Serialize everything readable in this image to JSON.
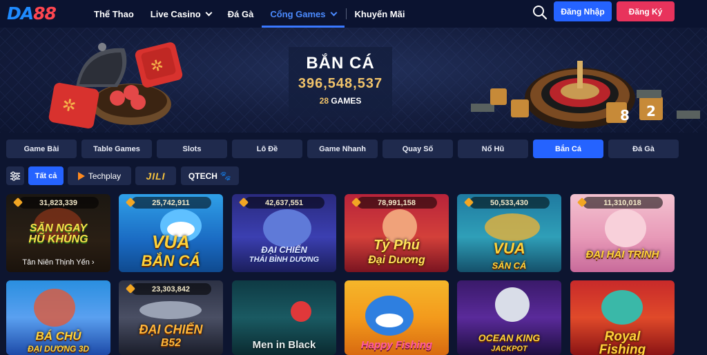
{
  "header": {
    "logo_part1": "DA",
    "logo_part2": "88",
    "nav": [
      {
        "label": "Thể Thao"
      },
      {
        "label": "Live Casino"
      },
      {
        "label": "Đá Gà"
      },
      {
        "label": "Cổng Games"
      },
      {
        "label": "Khuyến Mãi"
      }
    ],
    "login_label": "Đăng Nhập",
    "register_label": "Đăng Ký"
  },
  "banner": {
    "title": "BẮN CÁ",
    "amount": "396,548,537",
    "games_count": "28",
    "games_word": "GAMES"
  },
  "categories": [
    {
      "label": "Game Bài"
    },
    {
      "label": "Table Games"
    },
    {
      "label": "Slots"
    },
    {
      "label": "Lô Đề"
    },
    {
      "label": "Game Nhanh"
    },
    {
      "label": "Quay Số"
    },
    {
      "label": "Nổ Hũ"
    },
    {
      "label": "Bắn Cá",
      "active": true
    },
    {
      "label": "Đá Gà"
    }
  ],
  "providers": {
    "all_label": "Tất cả",
    "techplay_label": "Techplay",
    "jili_label": "JILI",
    "qtech_label": "QTECH"
  },
  "games_row1": [
    {
      "jackpot": "31,823,339",
      "title_line1": "SĂN NGAY",
      "title_line2": "HŨ KHỦNG",
      "subtitle": "Tân Niên Thịnh Yến ›"
    },
    {
      "jackpot": "25,742,911",
      "title_line1": "VUA",
      "title_line2": "BẮN CÁ"
    },
    {
      "jackpot": "42,637,551",
      "title_line1": "ĐẠI CHIẾN",
      "title_line2": "THÁI BÌNH DƯƠNG"
    },
    {
      "jackpot": "78,991,158",
      "title_line1": "Tỷ Phú",
      "title_line2": "Đại Dương"
    },
    {
      "jackpot": "50,533,430",
      "title_line1": "VUA",
      "title_line2": "SĂN CÁ"
    },
    {
      "jackpot": "11,310,018",
      "title_line1": "ĐẠI HẢI TRÌNH",
      "title_line2": ""
    }
  ],
  "games_row2": [
    {
      "title_line1": "BÁ CHỦ",
      "title_line2": "ĐẠI DƯƠNG 3D"
    },
    {
      "jackpot": "23,303,842",
      "title_line1": "ĐẠI CHIẾN",
      "title_line2": "B52"
    },
    {
      "title_line1": "Men in Black",
      "title_line2": ""
    },
    {
      "title_line1": "Happy Fishing",
      "title_line2": ""
    },
    {
      "title_line1": "OCEAN KING",
      "title_line2": "JACKPOT"
    },
    {
      "title_line1": "Royal",
      "title_line2": "Fishing"
    }
  ],
  "colors": {
    "accent": "#2563ff",
    "register": "#e8335c",
    "gold": "#f2c46a",
    "background": "#0d1530"
  }
}
